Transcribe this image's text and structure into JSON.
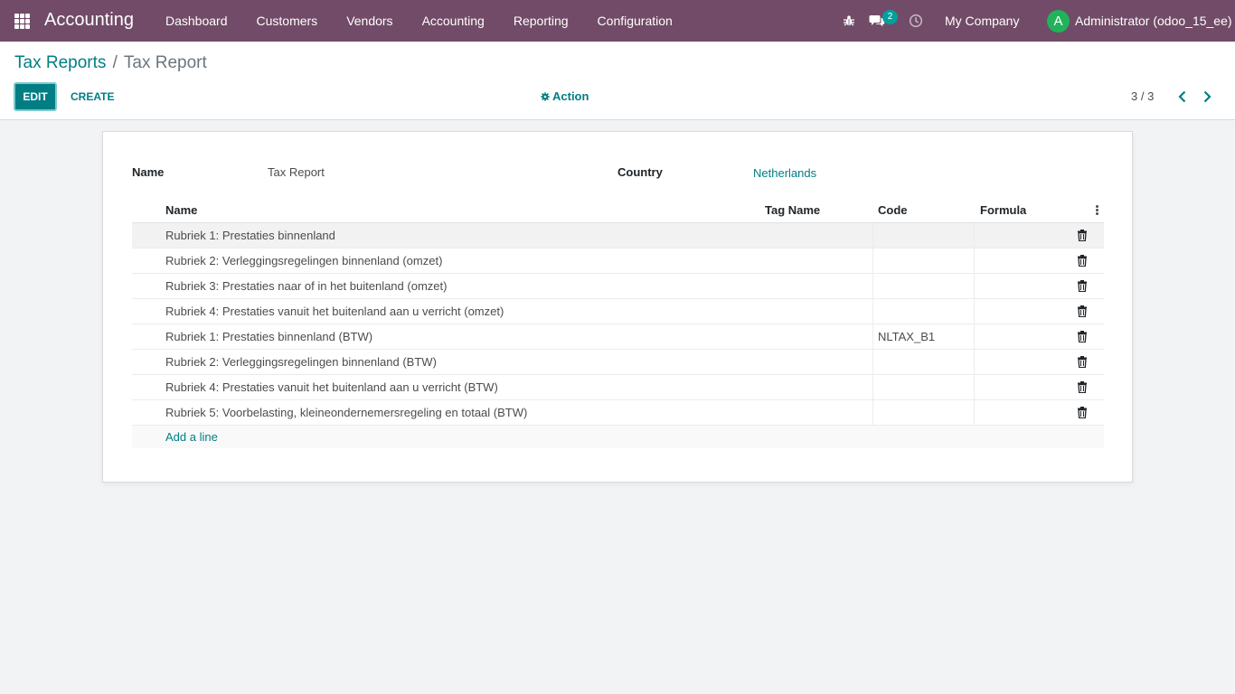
{
  "navbar": {
    "app_name": "Accounting",
    "menu": [
      "Dashboard",
      "Customers",
      "Vendors",
      "Accounting",
      "Reporting",
      "Configuration"
    ],
    "chat_count": "2",
    "company": "My Company",
    "avatar_letter": "A",
    "user": "Administrator (odoo_15_ee)",
    "brand_color": "#714b67"
  },
  "control": {
    "breadcrumb_parent": "Tax Reports",
    "breadcrumb_sep": "/",
    "breadcrumb_current": "Tax Report",
    "edit_label": "EDIT",
    "create_label": "CREATE",
    "action_label": "Action",
    "pager": "3 / 3"
  },
  "form": {
    "name_label": "Name",
    "name_value": "Tax Report",
    "country_label": "Country",
    "country_value": "Netherlands"
  },
  "table": {
    "columns": [
      "Name",
      "Tag Name",
      "Code",
      "Formula"
    ],
    "rows": [
      {
        "name": "Rubriek 1: Prestaties binnenland",
        "code": ""
      },
      {
        "name": "Rubriek 2: Verleggingsregelingen binnenland (omzet)",
        "code": ""
      },
      {
        "name": "Rubriek 3: Prestaties naar of in het buitenland (omzet)",
        "code": ""
      },
      {
        "name": "Rubriek 4: Prestaties vanuit het buitenland aan u verricht (omzet)",
        "code": ""
      },
      {
        "name": "Rubriek 1: Prestaties binnenland (BTW)",
        "code": "NLTAX_B1"
      },
      {
        "name": "Rubriek 2: Verleggingsregelingen binnenland (BTW)",
        "code": ""
      },
      {
        "name": "Rubriek 4: Prestaties vanuit het buitenland aan u verricht (BTW)",
        "code": ""
      },
      {
        "name": "Rubriek 5: Voorbelasting, kleineondernemersregeling en totaal (BTW)",
        "code": ""
      }
    ],
    "add_line": "Add a line"
  }
}
